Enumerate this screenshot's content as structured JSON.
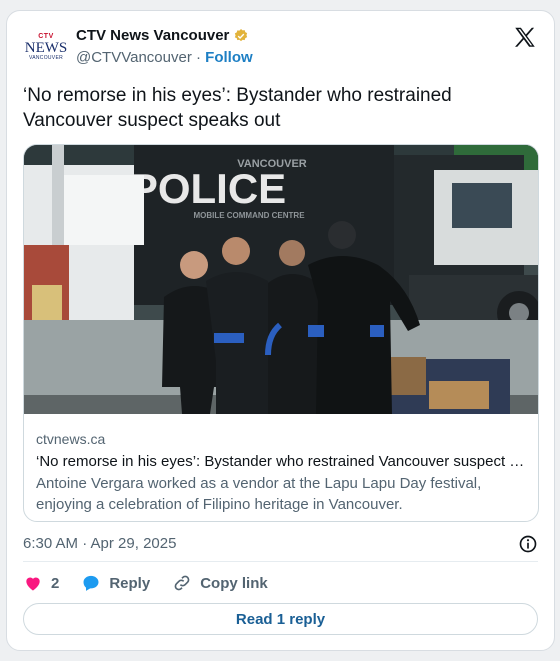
{
  "account": {
    "logo_ctv": "CTV",
    "logo_news": "NEWS",
    "logo_city": "VANCOUVER",
    "display_name": "CTV News Vancouver",
    "handle": "@CTVVancouver",
    "separator": "·",
    "follow_label": "Follow",
    "verified_color": "#e2b33b"
  },
  "tweet": {
    "text": "‘No remorse in his eyes’: Bystander who restrained Vancouver suspect speaks out"
  },
  "link_card": {
    "photo_sign_top": "VANCOUVER",
    "photo_sign": "POLICE",
    "photo_sign_bottom": "MOBILE COMMAND CENTRE",
    "domain": "ctvnews.ca",
    "title": "‘No remorse in his eyes’: Bystander who restrained Vancouver suspect speaks out",
    "description": "Antoine Vergara worked as a vendor at the Lapu Lapu Day festival, enjoying a celebration of Filipino heritage in Vancouver."
  },
  "meta": {
    "timestamp": "6:30 AM · Apr 29, 2025"
  },
  "actions": {
    "like_count": "2",
    "reply_label": "Reply",
    "copy_link_label": "Copy link",
    "like_color": "#f91880",
    "reply_color": "#1d9bf0"
  },
  "footer": {
    "read_reply_label": "Read 1 reply"
  }
}
